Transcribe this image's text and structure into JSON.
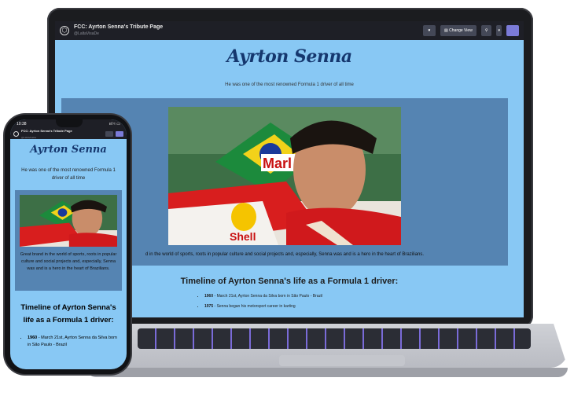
{
  "codepen": {
    "title": "FCC: Ayrton Senna's Tribute Page",
    "user": "@LaltaVisaDe",
    "change_view": "Change View"
  },
  "phone_status": {
    "time": "10:38",
    "signal": "ııl ≈ ▭"
  },
  "page": {
    "title": "Ayrton Senna",
    "subtitle": "He was one of the most renowned Formula 1 driver of all time",
    "caption_laptop": "d in the world of sports, roots in popular culture and social projects and, especially, Senna was and is a hero in the heart of Brazilians.",
    "caption_phone": "Great brand in the world of sports, roots in popular culture and social projects and, especially, Senna was and is a hero in the heart of Brazilians.",
    "timeline_heading": "Timeline of Ayrton Senna's life as a Formula 1 driver:",
    "timeline": [
      {
        "year": "1960",
        "text": " - March 21st, Ayrton Senna da Silva born in São Paulo - Brazil"
      },
      {
        "year": "1975",
        "text": " - Senna began his motorsport career in karting"
      }
    ],
    "phone_timeline": [
      {
        "year": "1960",
        "text": " - March 21st, Ayrton Senna da Silva born in São Paulo - Brazil"
      }
    ],
    "photo_text": {
      "sponsor1": "Marl",
      "sponsor2": "Shell"
    }
  },
  "colors": {
    "page_bg": "#88c8f4",
    "image_box": "#5584b2",
    "title": "#15376e",
    "toolbar": "#1e1f26"
  }
}
